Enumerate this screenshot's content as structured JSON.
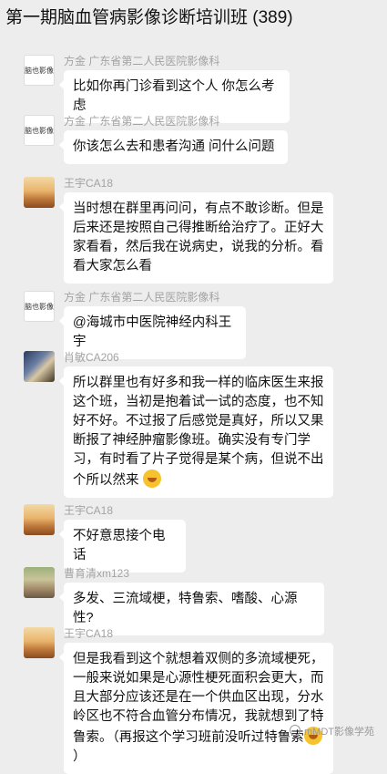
{
  "header": {
    "title": "第一期脑血管病影像诊断培训班 (389)"
  },
  "messages": [
    {
      "name": "方金 广东省第二人民医院影像科",
      "avatar": "logo",
      "avatar_text": "脑也影像",
      "text": "比如你再门诊看到这个人 你怎么考虑"
    },
    {
      "name": "方金 广东省第二人民医院影像科",
      "avatar": "logo",
      "avatar_text": "脑也影像",
      "text": "你该怎么去和患者沟通 问什么问题"
    },
    {
      "name": "王宇CA18",
      "avatar": "photo",
      "text": "当时想在群里再问问，有点不敢诊断。但是后来还是按照自己得推断给治疗了。正好大家看看，然后我在说病史，说我的分析。看看大家怎么看"
    },
    {
      "name": "方金 广东省第二人民医院影像科",
      "avatar": "logo",
      "avatar_text": "脑也影像",
      "text": "@海城市中医院神经内科王宇"
    },
    {
      "name": "肖敏CA206",
      "avatar": "photo",
      "text": "所以群里也有好多和我一样的临床医生来报这个班，当初是抱着试一试的态度，也不知好不好。不过报了后感觉是真好，所以又果断报了神经肿瘤影像班。确实没有专门学习，有时看了片子觉得是某个病，但说不出个所以然来",
      "emoji": "grimace-emoji"
    },
    {
      "name": "王宇CA18",
      "avatar": "photo",
      "text": "不好意思接个电话"
    },
    {
      "name": "曹育清xm123",
      "avatar": "photo",
      "text": "多发、三流域梗，特鲁索、嗜酸、心源性?"
    },
    {
      "name": "王宇CA18",
      "avatar": "photo",
      "text": "但是我看到这个就想着双侧的多流域梗死，一般来说如果是心源性梗死面积会更大，而且大部分应该还是在一个供血区出现，分水岭区也不符合血管分布情况，我就想到了特鲁索。（再报这个学习班前没听过特鲁索",
      "tail": "）",
      "emoji": "grimace-emoji"
    }
  ],
  "watermark": {
    "text": "mMDT影像学苑"
  }
}
